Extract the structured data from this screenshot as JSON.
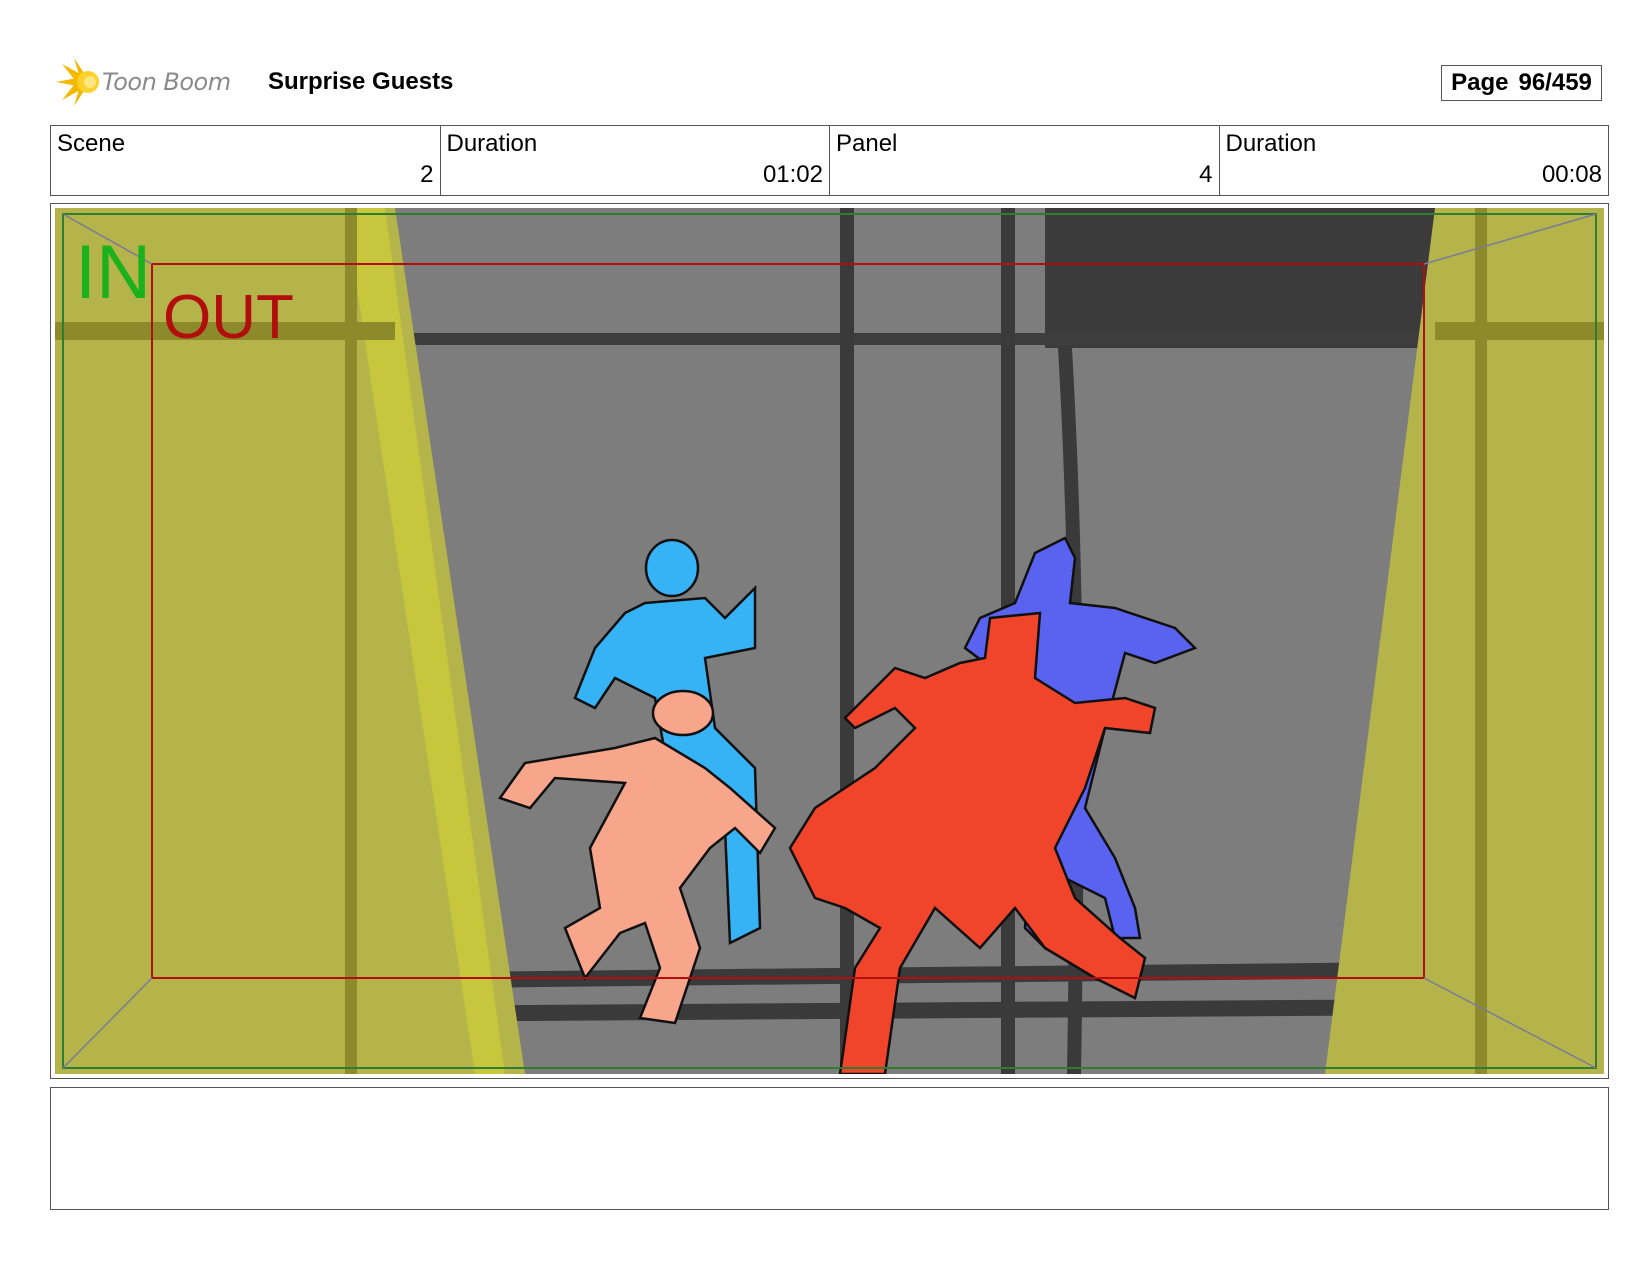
{
  "header": {
    "logo_text": "Toon Boom",
    "project_title": "Surprise Guests",
    "page_label": "Page",
    "page_number": "96/459"
  },
  "meta": {
    "scene_label": "Scene",
    "scene_value": "2",
    "scene_duration_label": "Duration",
    "scene_duration_value": "01:02",
    "panel_label": "Panel",
    "panel_value": "4",
    "panel_duration_label": "Duration",
    "panel_duration_value": "00:08"
  },
  "panel": {
    "in_label": "IN",
    "out_label": "OUT",
    "colors": {
      "background_gray": "#7d7d7d",
      "dark_gray": "#3b3b3b",
      "spotlight_yellow": "#b5b44a",
      "in_frame_green": "#1bb11b",
      "out_frame_red": "#b30e0e",
      "figure_cyan": "#35b3f5",
      "figure_blue": "#5a62f0",
      "figure_peach": "#f7a68c",
      "figure_red": "#f0452a"
    }
  },
  "notes": {
    "text": ""
  }
}
